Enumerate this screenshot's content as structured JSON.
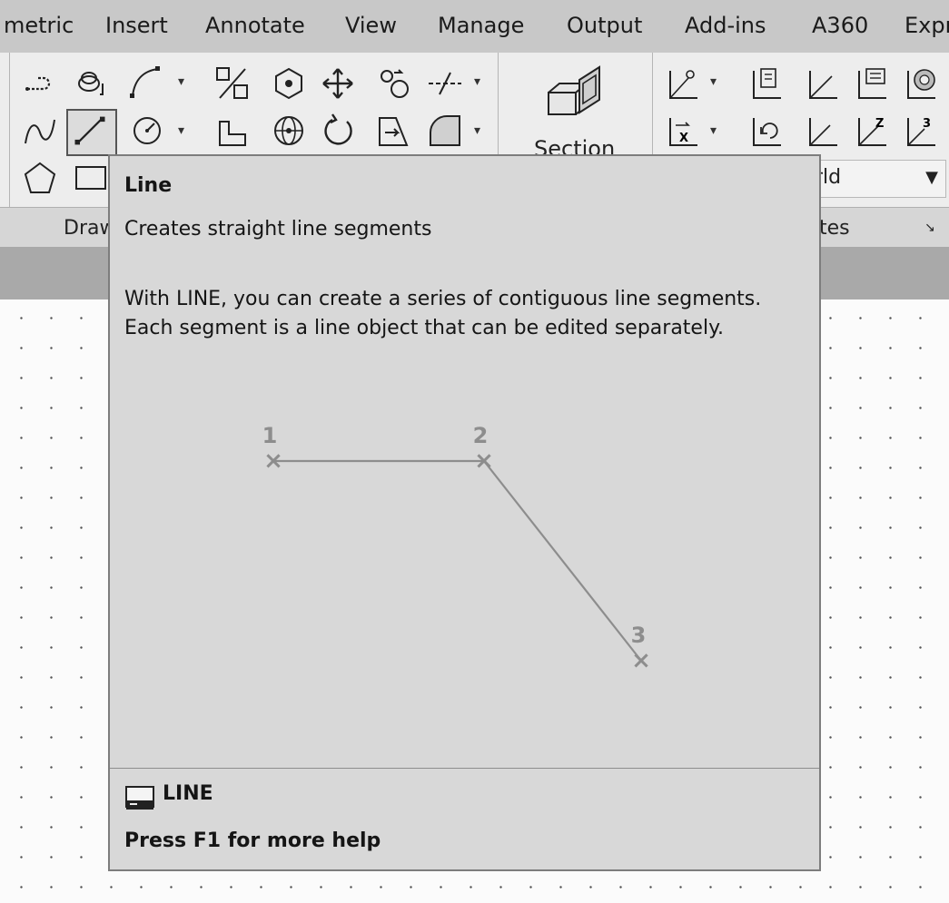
{
  "tabs": [
    "metric",
    "Insert",
    "Annotate",
    "View",
    "Manage",
    "Output",
    "Add-ins",
    "A360",
    "Expr"
  ],
  "panels": {
    "draw_title": "Draw",
    "coordinates_title": "tes",
    "section_label": "Section"
  },
  "ucs": {
    "value": "rld",
    "arrow": "▼"
  },
  "tooltip": {
    "title": "Line",
    "description": "Creates straight line segments",
    "body_line1": "With LINE, you can create a series of contiguous line segments.",
    "body_line2": "Each segment is a line object that can be edited separately.",
    "points": [
      "1",
      "2",
      "3"
    ],
    "command": "LINE",
    "help": "Press F1 for more help"
  },
  "icons": {
    "draw": [
      "polyline-icon",
      "circle-icon",
      "arc-icon",
      "spline-icon",
      "line-icon",
      "arc-dropdown-icon",
      "polygon-icon",
      "rectangle-icon"
    ],
    "modify": [
      "percent-icon",
      "move-icon",
      "move-arrows-icon",
      "copy-icon",
      "dashed-line-icon",
      "extrude-icon",
      "sphere-icon",
      "rotate-icon",
      "section-plane-icon",
      "fillet-icon"
    ],
    "coordinates": [
      "ucs-icon",
      "ucs-named-icon",
      "ucs-world-icon",
      "ucs-view-icon",
      "ucs-object-icon",
      "ucs-x-icon",
      "ucs-previous-icon",
      "ucs-y-icon",
      "ucs-z-icon",
      "ucs-3point-icon"
    ]
  },
  "colors": {
    "tooltip_bg": "#d8d8d8",
    "illustration_gray": "#8d8d8d",
    "ribbon_bg": "#ededed"
  }
}
